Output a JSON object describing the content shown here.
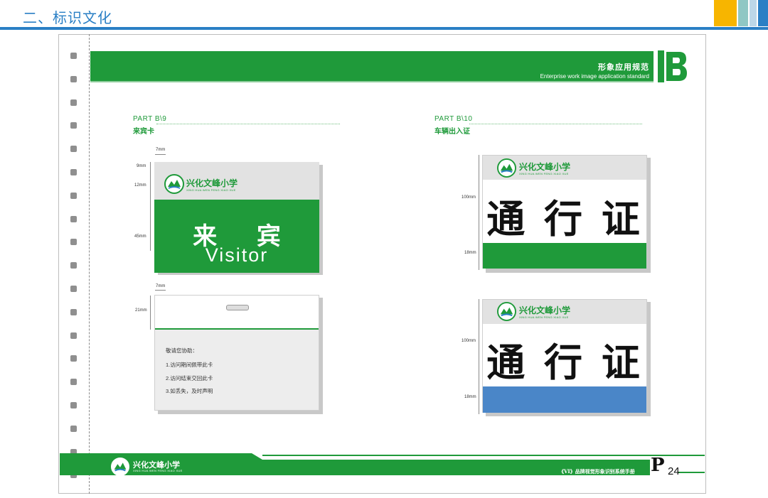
{
  "header": {
    "title": "二、标识文化"
  },
  "colors": {
    "green": "#1f9a3a",
    "blue": "#4a86c8",
    "topblue": "#2a7fc5",
    "yellow": "#f7b500",
    "teal": "#8fc7c4"
  },
  "band": {
    "title_cn": "形象应用规范",
    "title_en": "Enterprise work image application standard",
    "letter": "B"
  },
  "left": {
    "part": "PART   B\\9",
    "subtitle": "来宾卡",
    "school_cn": "兴化文峰小学",
    "school_en": "XING HUA WEN FENG XIAO XUE",
    "card_title": "来 宾",
    "card_en": "Visitor",
    "dims": {
      "d1": "7mm",
      "d2": "9mm",
      "d3": "12mm",
      "d4": "45mm",
      "d5": "7mm",
      "d6": "21mm"
    },
    "notes": [
      "敬请您协助：",
      "1.访问期间佩带此卡",
      "2.访问结束交回此卡",
      "3.如丢失，及时声明"
    ]
  },
  "right": {
    "part": "PART   B\\10",
    "subtitle": "车辆出入证",
    "school_cn": "兴化文峰小学",
    "school_en": "XING HUA WEN FENG XIAO XUE",
    "pass_text": "通 行 证",
    "dims": {
      "a1": "100mm",
      "a2": "18mm",
      "b1": "100mm",
      "b2": "18mm"
    }
  },
  "footer": {
    "school_cn": "兴化文峰小学",
    "school_en": "XING HUA WEN FENG XIAO XUE",
    "manual": "《VI》品牌视觉形象识别系统手册",
    "page_letter": "P",
    "page_num": "24"
  }
}
